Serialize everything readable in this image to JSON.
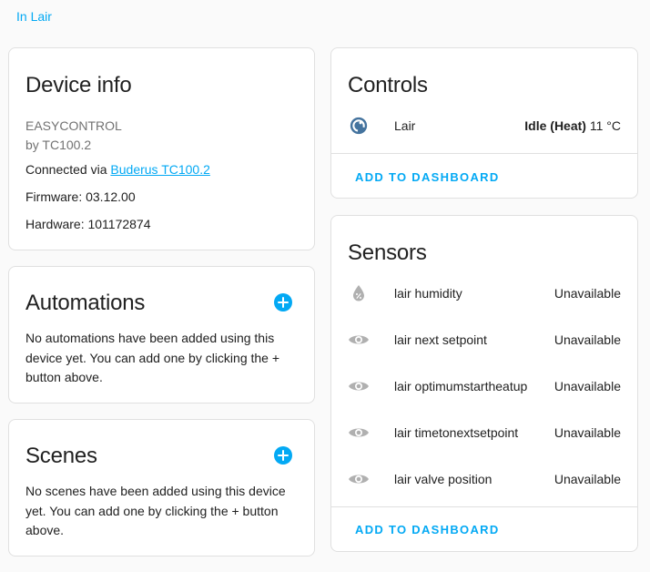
{
  "breadcrumb": {
    "area_link": "In Lair"
  },
  "device_info": {
    "title": "Device info",
    "model": "EASYCONTROL",
    "manufacturer": "by TC100.2",
    "connected_prefix": "Connected via ",
    "connected_link": "Buderus TC100.2",
    "firmware": "Firmware: 03.12.00",
    "hardware": "Hardware: 101172874"
  },
  "automations": {
    "title": "Automations",
    "text": "No automations have been added using this device yet. You can add one by clicking the + button above."
  },
  "scenes": {
    "title": "Scenes",
    "text": "No scenes have been added using this device yet. You can add one by clicking the + button above."
  },
  "controls": {
    "title": "Controls",
    "entity": {
      "name": "Lair",
      "state_bold": "Idle (Heat)",
      "temperature": " 11 °C",
      "icon": "thermostat-icon"
    },
    "dashboard_button": "ADD TO DASHBOARD"
  },
  "sensors": {
    "title": "Sensors",
    "items": [
      {
        "name": "lair humidity",
        "state": "Unavailable",
        "icon": "water-percent-icon"
      },
      {
        "name": "lair next setpoint",
        "state": "Unavailable",
        "icon": "eye-icon"
      },
      {
        "name": "lair optimumstartheatup",
        "state": "Unavailable",
        "icon": "eye-icon"
      },
      {
        "name": "lair timetonextsetpoint",
        "state": "Unavailable",
        "icon": "eye-icon"
      },
      {
        "name": "lair valve position",
        "state": "Unavailable",
        "icon": "eye-icon"
      }
    ],
    "dashboard_button": "ADD TO DASHBOARD"
  },
  "colors": {
    "accent": "#03a9f4",
    "icon_gray": "#b0b0b0",
    "thermostat": "#44739e"
  }
}
